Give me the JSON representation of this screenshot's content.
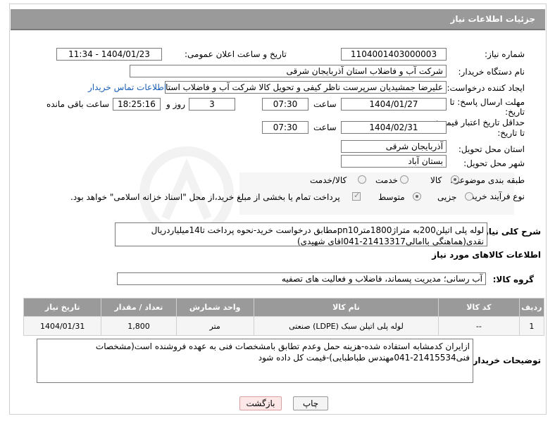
{
  "header": {
    "title": "جزئیات اطلاعات نیاز"
  },
  "need_number": {
    "label": "شماره نیاز:",
    "value": "1104001403000003"
  },
  "announce_datetime": {
    "label": "تاریخ و ساعت اعلان عمومی:",
    "value": "1404/01/23 - 11:34"
  },
  "buyer_org": {
    "label": "نام دستگاه خریدار:",
    "value": "شرکت آب و فاضلاب استان آذربایجان شرقی"
  },
  "requester": {
    "label": "ایجاد کننده درخواست:",
    "value": "علیرضا جمشیدیان سرپرست ناظر کیفی و تحویل کالا شرکت آب و فاضلاب استان",
    "contact_link": "اطلاعات تماس خریدار"
  },
  "reply_deadline": {
    "label_line1": "مهلت ارسال پاسخ: تا",
    "label_line2": "تاریخ:",
    "date": "1404/01/27",
    "time_label": "ساعت",
    "time": "07:30",
    "days": "3",
    "days_label": "روز و",
    "remaining": "18:25:16",
    "remaining_label": "ساعت باقی مانده"
  },
  "price_validity": {
    "label_line1": "حداقل تاریخ اعتبار قیمت:",
    "label_line2": "تا تاریخ:",
    "date": "1404/02/31",
    "time_label": "ساعت",
    "time": "07:30"
  },
  "delivery_province": {
    "label": "استان محل تحویل:",
    "value": "آذربایجان شرقی"
  },
  "delivery_city": {
    "label": "شهر محل تحویل:",
    "value": "بستان آباد"
  },
  "category": {
    "label": "طبقه بندی موضوعی:",
    "options": [
      "کالا",
      "خدمت",
      "کالا/خدمت"
    ],
    "selected": "کالا"
  },
  "purchase_process": {
    "label": "نوع فرآیند خرید :",
    "options": [
      "جزیی",
      "متوسط"
    ],
    "selected": "متوسط",
    "payment_note": "پرداخت تمام یا بخشی از مبلغ خرید،از محل \"اسناد خزانه اسلامی\" خواهد بود."
  },
  "general_description": {
    "label": "شرح کلی نیاز:",
    "value": "لوله پلی اتیلن200به متراژ1800مترpn10مطابق درخواست خرید-نحوه پرداخت تا14میلیاردریال نقدی(هماهنگی باامالی21413317-041اقای شهیدی)"
  },
  "goods_info": {
    "title": "اطلاعات کالاهای مورد نیاز"
  },
  "goods_group": {
    "label": "گروه کالا:",
    "value": "آب رسانی؛ مدیریت پسماند، فاضلاب و فعالیت های تصفیه"
  },
  "items_table": {
    "headers": [
      "ردیف",
      "کد کالا",
      "نام کالا",
      "واحد شمارش",
      "تعداد / مقدار",
      "تاریخ نیاز"
    ],
    "rows": [
      {
        "row": "1",
        "code": "--",
        "name": "لوله پلی اتیلن سبک (LDPE) صنعتی",
        "unit": "متر",
        "qty": "1,800",
        "date": "1404/01/31"
      }
    ]
  },
  "buyer_notes": {
    "label": "توضیحات خریدار:",
    "value": "ازایران کدمشابه استفاده شده-هزینه حمل وعدم تطابق بامشخصات فنی به عهده فروشنده است(مشخصات فنی21415534-041مهندس طباطبایی)-قیمت کل داده شود"
  },
  "buttons": {
    "print": "چاپ",
    "back": "بازگشت"
  },
  "colors": {
    "header_bg": "#9a9a9a",
    "link": "#1a5fb4",
    "back_button_bg": "#fde7e7"
  }
}
